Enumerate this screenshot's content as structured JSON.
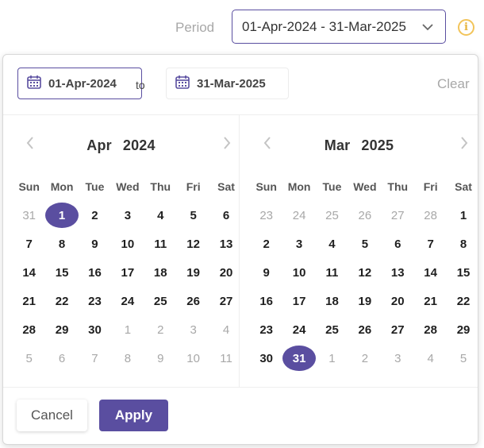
{
  "period": {
    "label": "Period",
    "selected_value": "01-Apr-2024 - 31-Mar-2025"
  },
  "range": {
    "start_value": "01-Apr-2024",
    "to_label": "to",
    "end_value": "31-Mar-2025",
    "clear_label": "Clear"
  },
  "calendars": {
    "left": {
      "month": "Apr",
      "year": "2024",
      "weekdays": [
        "Sun",
        "Mon",
        "Tue",
        "Wed",
        "Thu",
        "Fri",
        "Sat"
      ],
      "weeks": [
        [
          "31",
          "1",
          "2",
          "3",
          "4",
          "5",
          "6"
        ],
        [
          "7",
          "8",
          "9",
          "10",
          "11",
          "12",
          "13"
        ],
        [
          "14",
          "15",
          "16",
          "17",
          "18",
          "19",
          "20"
        ],
        [
          "21",
          "22",
          "23",
          "24",
          "25",
          "26",
          "27"
        ],
        [
          "28",
          "29",
          "30",
          "1",
          "2",
          "3",
          "4"
        ],
        [
          "5",
          "6",
          "7",
          "8",
          "9",
          "10",
          "11"
        ]
      ]
    },
    "right": {
      "month": "Mar",
      "year": "2025",
      "weekdays": [
        "Sun",
        "Mon",
        "Tue",
        "Wed",
        "Thu",
        "Fri",
        "Sat"
      ],
      "weeks": [
        [
          "23",
          "24",
          "25",
          "26",
          "27",
          "28",
          "1"
        ],
        [
          "2",
          "3",
          "4",
          "5",
          "6",
          "7",
          "8"
        ],
        [
          "9",
          "10",
          "11",
          "12",
          "13",
          "14",
          "15"
        ],
        [
          "16",
          "17",
          "18",
          "19",
          "20",
          "21",
          "22"
        ],
        [
          "23",
          "24",
          "25",
          "26",
          "27",
          "28",
          "29"
        ],
        [
          "30",
          "31",
          "1",
          "2",
          "3",
          "4",
          "5"
        ]
      ]
    }
  },
  "footer": {
    "cancel_label": "Cancel",
    "apply_label": "Apply"
  },
  "colors": {
    "accent": "#5a4ea0",
    "muted_text": "#a8a8a8",
    "info_icon": "#f2c45a"
  },
  "icons": {
    "dropdown": "chevron-down-icon",
    "info": "info-icon",
    "calendar": "calendar-icon",
    "prev": "chevron-left-icon",
    "next": "chevron-right-icon"
  }
}
